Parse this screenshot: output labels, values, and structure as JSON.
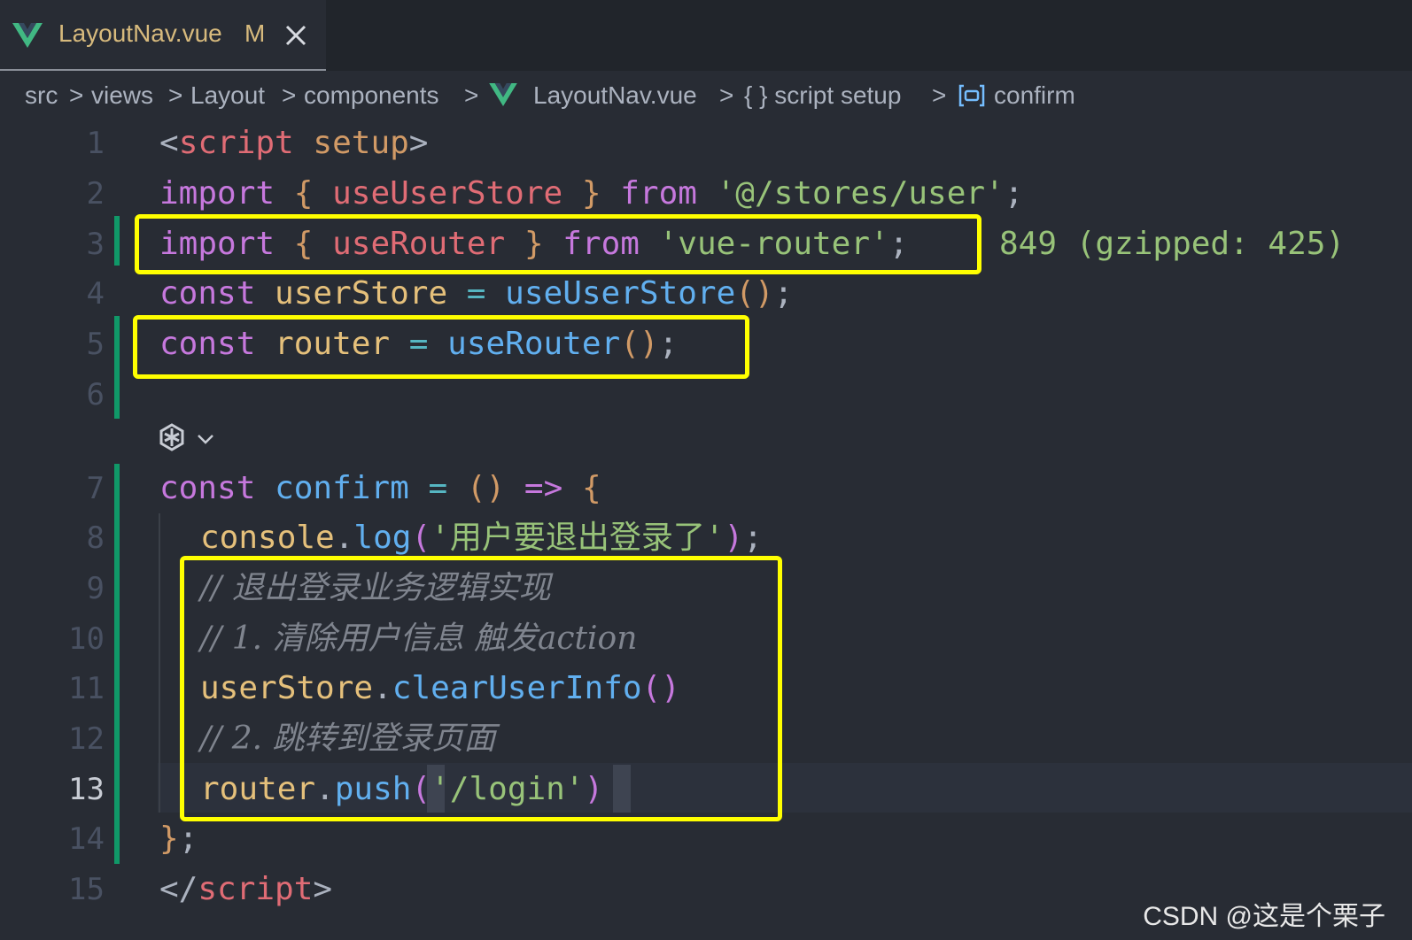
{
  "tab": {
    "file_name": "LayoutNav.vue",
    "status": "M"
  },
  "breadcrumb": {
    "items": [
      "src",
      "views",
      "Layout",
      "components",
      "LayoutNav.vue",
      "{ } script setup",
      "confirm"
    ],
    "separator": ">"
  },
  "gutter": {
    "line_numbers": [
      "1",
      "2",
      "3",
      "4",
      "5",
      "6",
      "7",
      "8",
      "9",
      "10",
      "11",
      "12",
      "13",
      "14",
      "15"
    ],
    "active_line": "13"
  },
  "code": {
    "l1": [
      "<",
      "script",
      " ",
      "setup",
      ">"
    ],
    "l2": [
      "import",
      " ",
      "{",
      " useUserStore ",
      "}",
      " ",
      "from",
      " ",
      "'@/stores/user'",
      ";"
    ],
    "l3": [
      "import",
      " ",
      "{",
      " useRouter ",
      "}",
      " ",
      "from",
      " ",
      "'vue-router'",
      ";"
    ],
    "l3_inlay": "849 (gzipped: 425)",
    "l4": [
      "const",
      " userStore ",
      "=",
      " ",
      "useUserStore",
      "(",
      ")",
      ";"
    ],
    "l5": [
      "const",
      " router ",
      "=",
      " ",
      "useRouter",
      "(",
      ")",
      ";"
    ],
    "l7": [
      "const",
      " ",
      "confirm",
      " ",
      "=",
      " ",
      "(",
      ")",
      " ",
      "=>",
      " ",
      "{"
    ],
    "l8": [
      "console",
      ".",
      "log",
      "(",
      "'",
      "用户要退出登录了",
      "'",
      ")",
      ";"
    ],
    "l9": "// 退出登录业务逻辑实现",
    "l10": "// 1. 清除用户信息 触发action",
    "l11": [
      "userStore",
      ".",
      "clearUserInfo",
      "(",
      ")"
    ],
    "l12": "// 2. 跳转到登录页面",
    "l13": [
      "router",
      ".",
      "push",
      "(",
      "'/login'",
      ")"
    ],
    "l14": [
      "}",
      ";"
    ],
    "l15": [
      "</",
      "script",
      ">"
    ]
  },
  "watermark": "CSDN @这是个栗子",
  "colors": {
    "editor_bg": "#282c34",
    "highlight_box": "#ffff00",
    "git_modified_bar": "#109868",
    "keyword": "#c678dd",
    "string": "#98c379",
    "function": "#61afef"
  }
}
